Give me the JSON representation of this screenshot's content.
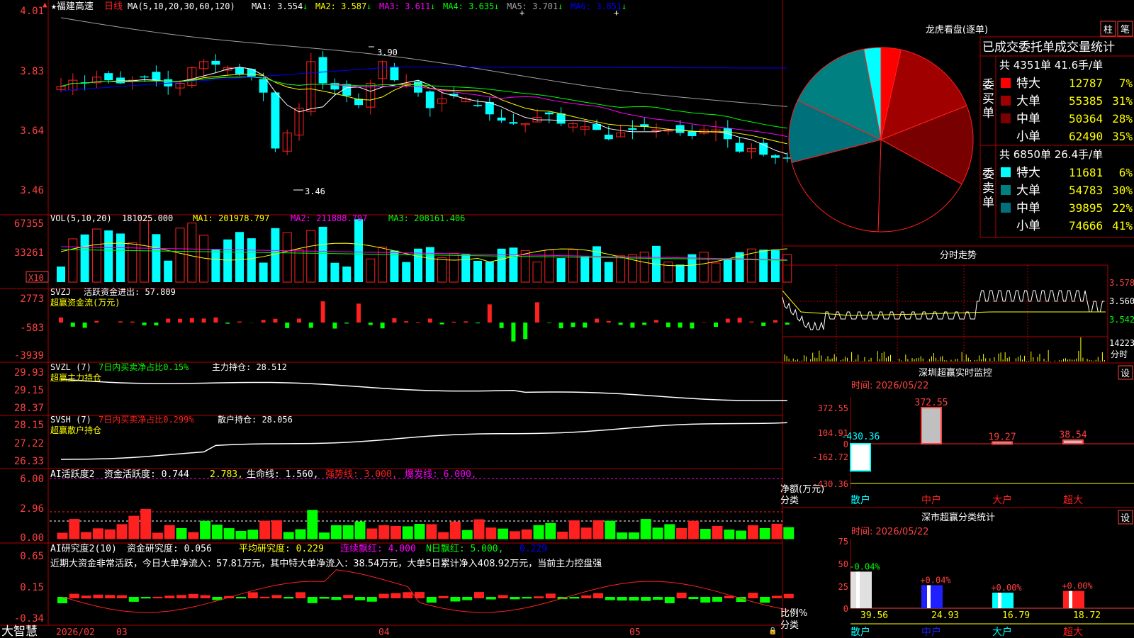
{
  "colors": {
    "bg": "#000000",
    "border": "#b00000",
    "up": "#ff2020",
    "down": "#00ffff",
    "axis": "#ff4040",
    "white": "#ffffff",
    "yellow": "#ffff00",
    "magenta": "#ff00ff",
    "green": "#00ff00",
    "blue": "#0000ff",
    "gray": "#a0a0a0"
  },
  "header": {
    "stock": "★福建高速",
    "period": "日线",
    "ma_title": "MA(5,10,20,30,60,120)",
    "ma": [
      {
        "label": "MA1: 3.554",
        "arrow": "↓",
        "color": "#ffffff"
      },
      {
        "label": "MA2: 3.587",
        "arrow": "↓",
        "color": "#ffff00"
      },
      {
        "label": "MA3: 3.611",
        "arrow": "↓",
        "color": "#ff00ff"
      },
      {
        "label": "MA4: 3.635",
        "arrow": "↓",
        "color": "#00ff00"
      },
      {
        "label": "MA5: 3.701",
        "arrow": "↓",
        "color": "#a0a0a0"
      },
      {
        "label": "MA6: 3.851",
        "arrow": "↓",
        "color": "#0000ff"
      }
    ]
  },
  "k_axis": [
    "4.01",
    "3.83",
    "3.64",
    "3.46"
  ],
  "k_annot": {
    "high": "3.90",
    "low": "3.46"
  },
  "vol": {
    "header": "VOL(5,10,20)",
    "value": "181025.000",
    "ma1": "MA1: 201978.797",
    "ma2": "MA2: 211888.797",
    "ma3": "MA3: 208161.406",
    "axis": [
      "67355",
      "33261"
    ],
    "unit": "X10"
  },
  "svzj": {
    "name": "SVZJ",
    "label1": "活跃资金进出: 57.809",
    "label2": "超赢资金流(万元)",
    "axis": [
      "2773",
      "-583",
      "-3939"
    ]
  },
  "svzl": {
    "name": "SVZL (7)",
    "label1": "7日内买卖净占比0.15%",
    "label2": "主力持仓: 28.512",
    "label3": "超赢主力持仓",
    "axis": [
      "29.93",
      "29.15",
      "28.37"
    ]
  },
  "svsh": {
    "name": "SVSH (7)",
    "label1": "7日内买卖净占比0.299%",
    "label2": "散户持仓: 28.056",
    "label3": "超赢散户持仓",
    "axis": [
      "28.15",
      "27.22",
      "26.33"
    ]
  },
  "ai_active": {
    "name": "AI活跃度2",
    "l1": "资金活跃度: 0.744",
    "l2": "2.783,",
    "l3": "生命线: 1.560,",
    "l4": "强势线: 3.000,",
    "l5": "爆发线: 6.000,",
    "axis": [
      "6.00",
      "2.96",
      "0.00"
    ]
  },
  "ai_research": {
    "name": "AI研究度2(10)",
    "l1": "资金研究度: 0.056",
    "l2": "平均研究度: 0.229",
    "l3": "连续飘红: 4.000",
    "l4": "N日飘红: 5.000,",
    "l5": "0.229",
    "comment": "近期大资金非常活跃，今日大单净流入：57.81万元，其中特大单净流入：38.54万元，大单5日累计净入408.92万元，当前主力控盘强",
    "axis": [
      "0.65",
      "0.15",
      "-0.34"
    ]
  },
  "dates": [
    "2026/02",
    "03",
    "04",
    "05"
  ],
  "footer": {
    "brand": "大智慧"
  },
  "dragon": {
    "title": "龙虎看盘(逐单)",
    "btn1": "柱",
    "btn2": "笔",
    "subtitle": "已成交委托单成交量统计",
    "buy_total": "共 4351单 41.6手/单",
    "sell_total": "共 6850单 26.4手/单",
    "buy_label": "委买单",
    "sell_label": "委卖单",
    "buy": [
      {
        "name": "特大",
        "value": "12787",
        "pct": "7%",
        "color": "#ff0000"
      },
      {
        "name": "大单",
        "value": "55385",
        "pct": "31%",
        "color": "#a00000"
      },
      {
        "name": "中单",
        "value": "50364",
        "pct": "28%",
        "color": "#780000"
      },
      {
        "name": "小单",
        "value": "62490",
        "pct": "35%",
        "color": "#000000"
      }
    ],
    "sell": [
      {
        "name": "特大",
        "value": "11681",
        "pct": "6%",
        "color": "#00ffff"
      },
      {
        "name": "大单",
        "value": "54783",
        "pct": "30%",
        "color": "#008080"
      },
      {
        "name": "中单",
        "value": "39895",
        "pct": "22%",
        "color": "#00707a"
      },
      {
        "name": "小单",
        "value": "74666",
        "pct": "41%",
        "color": "#000000"
      }
    ]
  },
  "intraday": {
    "title": "分时走势",
    "axis": [
      "3.578",
      "3.560",
      "3.542"
    ],
    "vol_value": "14223",
    "vol_label": "分时"
  },
  "monitor": {
    "title": "深圳超赢实时监控",
    "set": "设",
    "time": "时间: 2026/05/22",
    "axis": [
      "372.55",
      "104.91",
      "0",
      "-162.72",
      "-430.36"
    ],
    "ylabel1": "净额(万元)",
    "ylabel2": "分类",
    "categories": [
      "散户",
      "中户",
      "大户",
      "超大"
    ],
    "values": [
      -430.36,
      372.55,
      19.27,
      38.54
    ],
    "labels": [
      "-430.36",
      "372.55",
      "19.27",
      "38.54"
    ]
  },
  "classify": {
    "title": "深市超赢分类统计",
    "set": "设",
    "time": "时间: 2026/05/22",
    "axis": [
      "75",
      "50",
      "25",
      "0"
    ],
    "ylabel1": "比例%",
    "ylabel2": "分类",
    "categories": [
      "散户",
      "中户",
      "大户",
      "超大"
    ],
    "values": [
      39.56,
      24.93,
      16.79,
      18.72
    ],
    "value_labels": [
      "39.56",
      "24.93",
      "16.79",
      "18.72"
    ],
    "changes": [
      "-0.04%",
      "+0.04%",
      "+0.00%",
      "+0.00%"
    ],
    "colors": [
      "#e0e0e0",
      "#2020ff",
      "#00ffff",
      "#ff2020"
    ]
  }
}
